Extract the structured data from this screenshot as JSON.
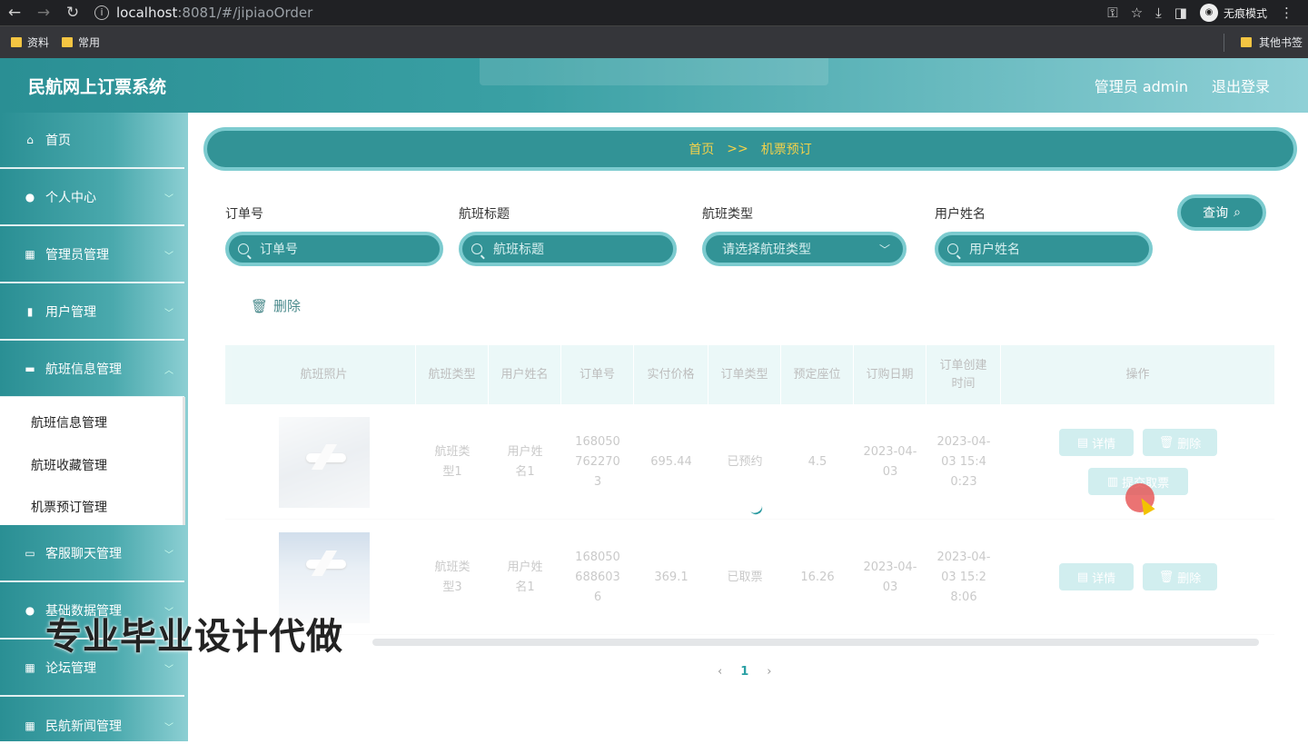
{
  "browser": {
    "url_host": "localhost",
    "url_port_path": ":8081/#/jipiaoOrder",
    "incognito_label": "无痕模式",
    "bookmarks": [
      "资料",
      "常用"
    ],
    "other_bookmarks": "其他书签"
  },
  "header": {
    "title": "民航网上订票系统",
    "user": "管理员 admin",
    "logout": "退出登录"
  },
  "sidebar": {
    "items": [
      {
        "label": "首页",
        "icon": "home-icon"
      },
      {
        "label": "个人中心",
        "icon": "user-icon"
      },
      {
        "label": "管理员管理",
        "icon": "grid-icon"
      },
      {
        "label": "用户管理",
        "icon": "chart-icon"
      },
      {
        "label": "航班信息管理",
        "icon": "monitor-icon"
      },
      {
        "label": "客服聊天管理",
        "icon": "chat-icon"
      },
      {
        "label": "基础数据管理",
        "icon": "user-icon"
      },
      {
        "label": "论坛管理",
        "icon": "grid-icon"
      },
      {
        "label": "民航新闻管理",
        "icon": "grid-icon"
      }
    ],
    "submenu": [
      "航班信息管理",
      "航班收藏管理",
      "机票预订管理"
    ]
  },
  "breadcrumb": {
    "home": "首页",
    "sep": ">>",
    "current": "机票预订"
  },
  "filters": {
    "order_no": {
      "label": "订单号",
      "placeholder": "订单号"
    },
    "flight_title": {
      "label": "航班标题",
      "placeholder": "航班标题"
    },
    "flight_type": {
      "label": "航班类型",
      "placeholder": "请选择航班类型"
    },
    "user_name": {
      "label": "用户姓名",
      "placeholder": "用户姓名"
    },
    "query": "查询"
  },
  "actions": {
    "delete": "删除"
  },
  "table": {
    "headers": [
      "航班照片",
      "航班类型",
      "用户姓名",
      "订单号",
      "实付价格",
      "订单类型",
      "预定座位",
      "订购日期",
      "订单创建时间",
      "操作"
    ],
    "rows": [
      {
        "type": "航班类型1",
        "user": "用户姓名1",
        "order": "1680507622703",
        "price": "695.44",
        "status": "已预约",
        "seat": "4.5",
        "date": "2023-04-03",
        "created": "2023-04-03 15:40:23",
        "ops": [
          "详情",
          "删除",
          "提交取票"
        ]
      },
      {
        "type": "航班类型3",
        "user": "用户姓名1",
        "order": "1680506886036",
        "price": "369.1",
        "status": "已取票",
        "seat": "16.26",
        "date": "2023-04-03",
        "created": "2023-04-03 15:28:06",
        "ops": [
          "详情",
          "删除"
        ]
      }
    ]
  },
  "pager": {
    "prev": "‹",
    "page": "1",
    "next": "›"
  },
  "watermark": "专业毕业设计代做"
}
